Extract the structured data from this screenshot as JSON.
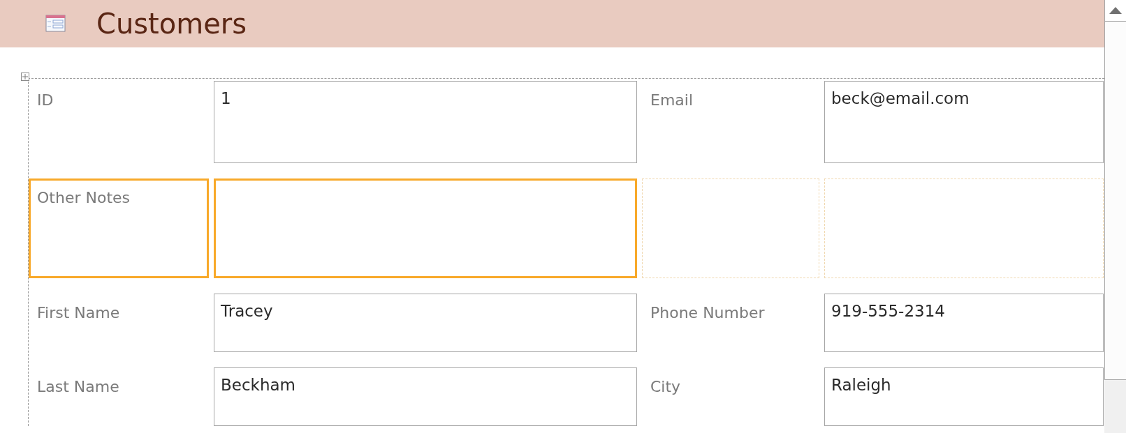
{
  "header": {
    "title": "Customers"
  },
  "rows": [
    {
      "cells": [
        {
          "kind": "label",
          "text": "ID",
          "selected": false
        },
        {
          "kind": "field",
          "value": "1",
          "selected": false
        },
        {
          "kind": "label",
          "text": "Email",
          "selected": false
        },
        {
          "kind": "field",
          "value": "beck@email.com",
          "selected": false
        }
      ]
    },
    {
      "cells": [
        {
          "kind": "label",
          "text": "Other Notes",
          "selected": true
        },
        {
          "kind": "field",
          "selected": true
        },
        {
          "kind": "empty"
        },
        {
          "kind": "empty"
        }
      ]
    },
    {
      "cells": [
        {
          "kind": "label",
          "text": "First Name",
          "selected": false
        },
        {
          "kind": "field",
          "value": "Tracey",
          "selected": false
        },
        {
          "kind": "label",
          "text": "Phone Number",
          "selected": false
        },
        {
          "kind": "field",
          "value": "919-555-2314",
          "selected": false
        }
      ]
    },
    {
      "cells": [
        {
          "kind": "label",
          "text": "Last Name",
          "selected": false
        },
        {
          "kind": "field",
          "value": "Beckham",
          "selected": false
        },
        {
          "kind": "label",
          "text": "City",
          "selected": false
        },
        {
          "kind": "field",
          "value": "Raleigh",
          "selected": false
        }
      ]
    }
  ]
}
